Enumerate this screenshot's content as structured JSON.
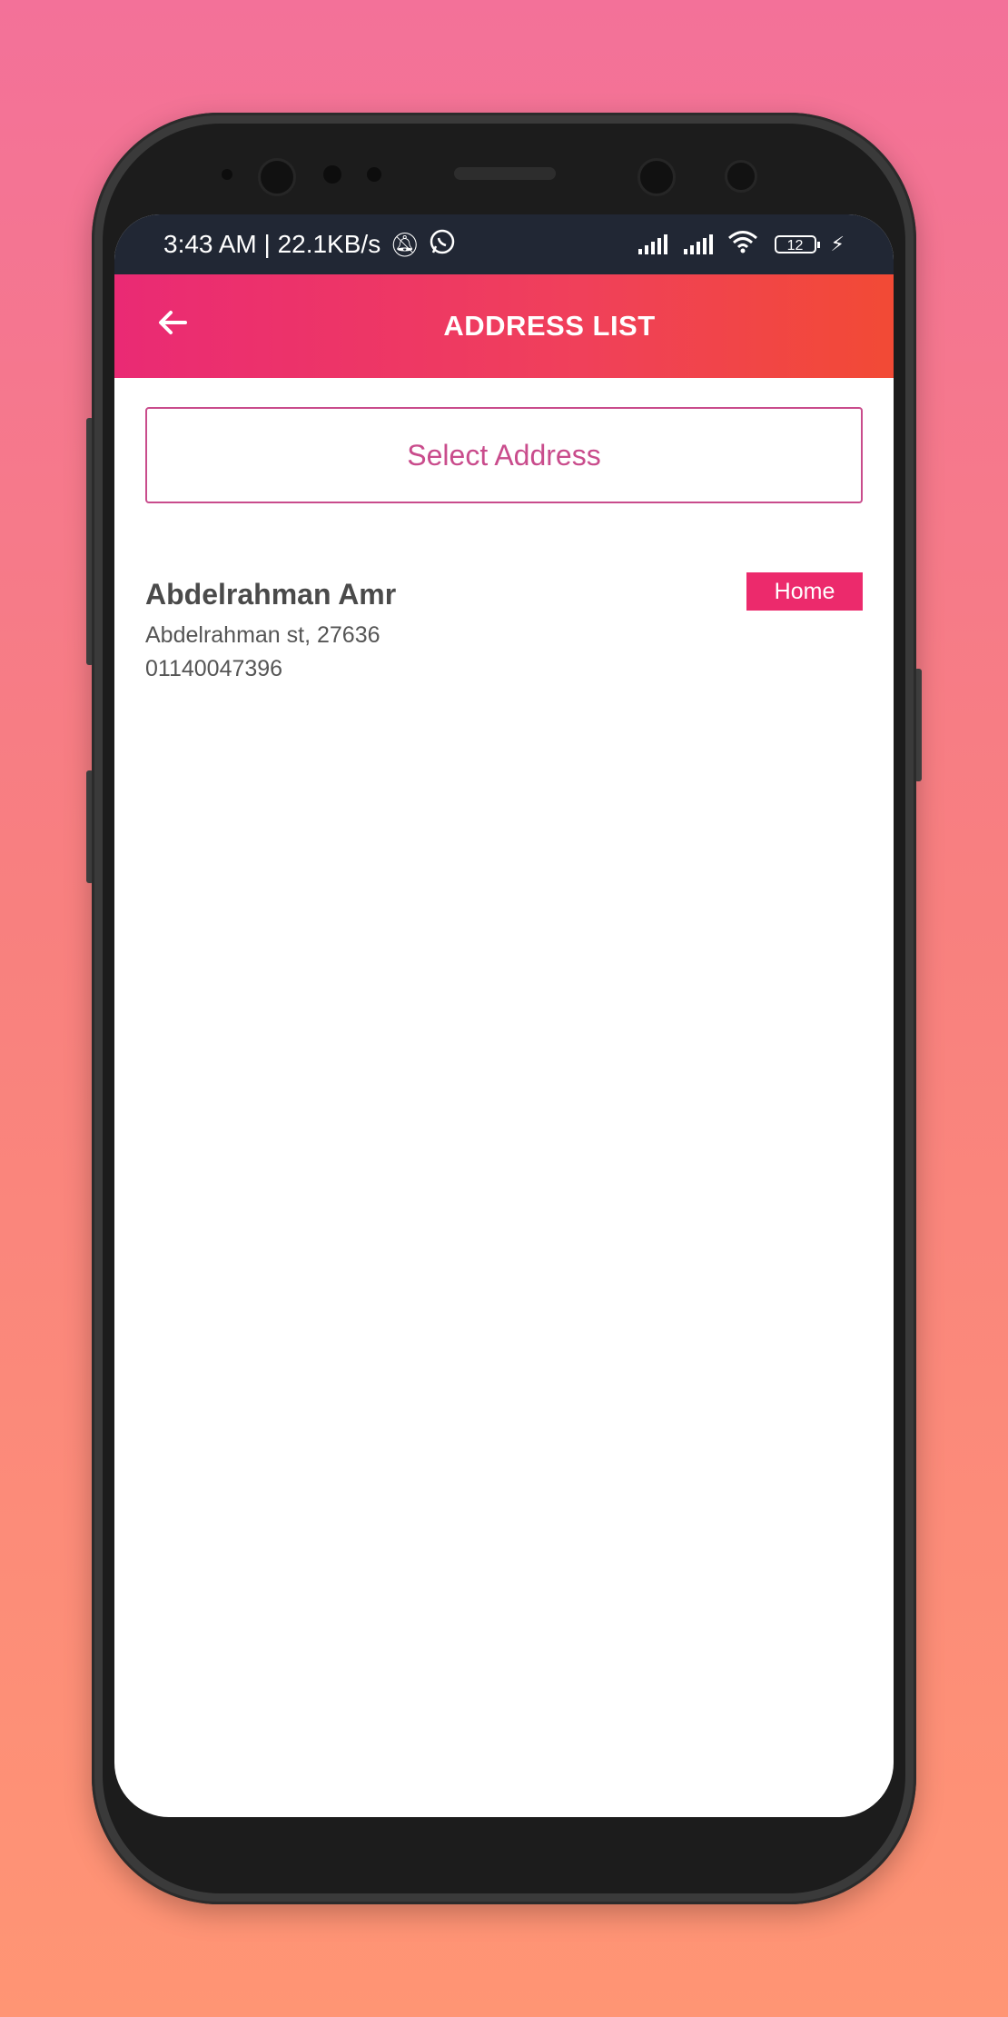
{
  "status_bar": {
    "time_speed": "3:43 AM | 22.1KB/s",
    "battery_level": "12",
    "icons": [
      "mute-bell-icon",
      "whatsapp-icon",
      "signal-icon",
      "signal-icon",
      "wifi-icon",
      "battery-icon",
      "charging-bolt-icon"
    ]
  },
  "appbar": {
    "title": "ADDRESS LIST",
    "back_icon": "arrow-left-icon"
  },
  "select_address_label": "Select Address",
  "address": {
    "name": "Abdelrahman Amr",
    "line": "Abdelrahman st, 27636",
    "phone": "01140047396",
    "tag": "Home"
  },
  "colors": {
    "appbar_start": "#ea2a74",
    "appbar_end": "#f24a35",
    "accent": "#c94c8c",
    "badge": "#ec2a6c"
  }
}
